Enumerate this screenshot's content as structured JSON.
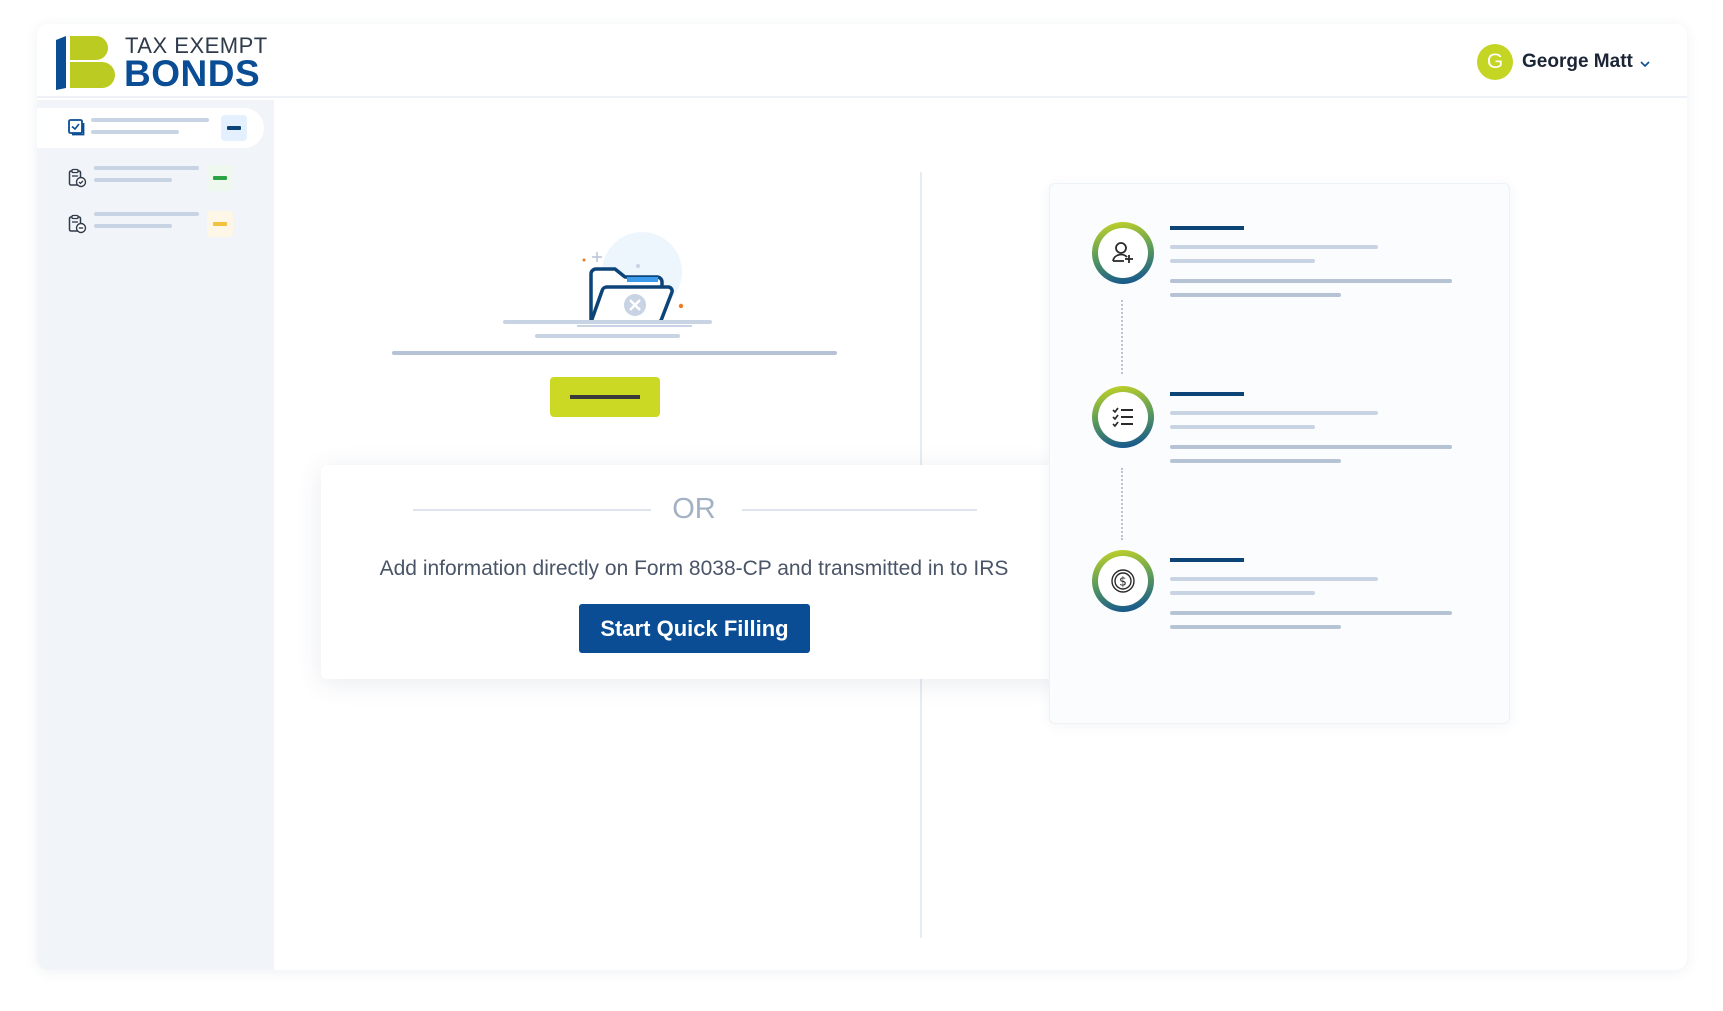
{
  "app": {
    "logo_top": "TAX EXEMPT",
    "logo_bottom": "BONDS",
    "brand_colors": {
      "primary_blue": "#0a4d94",
      "accent_green": "#c5d524"
    }
  },
  "user": {
    "initial": "G",
    "name": "George Matt",
    "menu_icon": "chevron-down-icon"
  },
  "sidebar": {
    "items": [
      {
        "icon": "checkbox-stack-icon",
        "badge_color": "#0c4478",
        "badge_bg": "#e4f0fd",
        "active": true
      },
      {
        "icon": "clipboard-check-icon",
        "badge_color": "#2aa345",
        "badge_bg": "#eef8ef",
        "active": false
      },
      {
        "icon": "clipboard-minus-icon",
        "badge_color": "#f2c23e",
        "badge_bg": "#fef7e8",
        "active": false
      }
    ]
  },
  "empty_state": {
    "illustration": "empty-folder-icon",
    "primary_button_icon": "placeholder-dash"
  },
  "quick_fill": {
    "or_label": "OR",
    "description": "Add information directly on Form 8038-CP and transmitted in to IRS",
    "button_label": "Start Quick Filling"
  },
  "steps": [
    {
      "icon": "user-add-icon"
    },
    {
      "icon": "checklist-icon"
    },
    {
      "icon": "dollar-coin-icon"
    }
  ]
}
